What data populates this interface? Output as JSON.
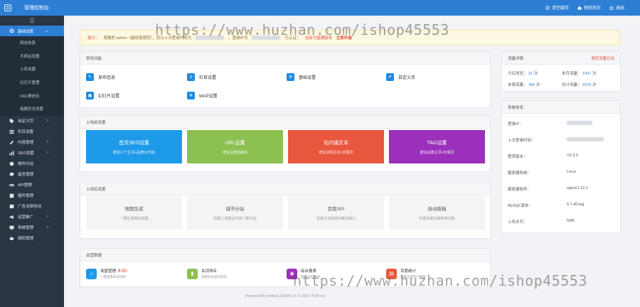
{
  "header": {
    "brand": "管理控制台",
    "tools": [
      {
        "label": "清空缓存",
        "icon": "gear-icon"
      },
      {
        "label": "预览前台",
        "icon": "home-icon"
      },
      {
        "label": "退出",
        "icon": "power-icon"
      }
    ]
  },
  "sidebar": {
    "toggle_icon": "menu-icon",
    "active": {
      "label": "基础设置",
      "icon": "gear-icon"
    },
    "sub_items": [
      "网站信息",
      "手机站设置",
      "上传设置",
      "幻灯片管理",
      "URL静态化",
      "每据安全设置"
    ],
    "items": [
      {
        "label": "自定义页",
        "icon": "tag-icon",
        "chevron": true
      },
      {
        "label": "栏目设置",
        "icon": "list-icon",
        "chevron": false
      },
      {
        "label": "内容管理",
        "icon": "edit-icon",
        "chevron": true
      },
      {
        "label": "SEO设置",
        "icon": "chart-icon",
        "chevron": true
      },
      {
        "label": "城市分站",
        "icon": "globe-icon",
        "chevron": false
      },
      {
        "label": "留言管理",
        "icon": "chat-icon",
        "chevron": false
      },
      {
        "label": "API管理",
        "icon": "link-icon",
        "chevron": false
      },
      {
        "label": "插件管理",
        "icon": "puzzle-icon",
        "chevron": false
      },
      {
        "label": "广告法禁用词",
        "icon": "book-icon",
        "chevron": false
      },
      {
        "label": "运营推广",
        "icon": "megaphone-icon",
        "chevron": true
      },
      {
        "label": "系统管理",
        "icon": "monitor-icon",
        "chevron": true
      },
      {
        "label": "授权管理",
        "icon": "cloud-icon",
        "chevron": false
      }
    ]
  },
  "notice": {
    "prefix": "提示：",
    "text": "尊敬的 admin（超级管理员），您以上次登录时间为",
    "text2": "，登录IP为",
    "text3": "已认证：",
    "highlight": "当前为普通版本",
    "upgrade": "立即升级"
  },
  "common": {
    "title": "常用功能",
    "items": [
      {
        "label": "发布信息",
        "icon": "edit-icon"
      },
      {
        "label": "栏目设置",
        "icon": "list-icon"
      },
      {
        "label": "基础设置",
        "icon": "gear-icon"
      },
      {
        "label": "自定义页",
        "icon": "pen-icon"
      },
      {
        "label": "幻灯片设置",
        "icon": "image-icon"
      },
      {
        "label": "WAP设置",
        "icon": "gear-icon"
      }
    ]
  },
  "before": {
    "title": "上线前设置",
    "cards": [
      {
        "title": "首页SEO设置",
        "sub": "建议三个主词+品牌/公司名",
        "color": "#1e9be8"
      },
      {
        "title": "URL设置",
        "sub": "建议设置伪静态",
        "color": "#8cc152"
      },
      {
        "title": "站内锚文本",
        "sub": "建议添加主词+长尾词",
        "color": "#e9573f"
      },
      {
        "title": "TAG设置",
        "sub": "建议设置主词+长尾词",
        "color": "#9b30ba"
      }
    ]
  },
  "after": {
    "title": "上线后设置",
    "cards": [
      {
        "title": "地图生成",
        "sub": "一键生成网站地图"
      },
      {
        "title": "城市分站",
        "sub": "初期上线建议开启少量分站"
      },
      {
        "title": "百度API",
        "sub": "百度主动及被动推送接口"
      },
      {
        "title": "自动拨箱",
        "sub": "权重依赖全链时等文稿"
      }
    ]
  },
  "ops": {
    "title": "运营数据",
    "items": [
      {
        "title": "询盘管理",
        "badge": "未读0",
        "sub": "一键查看未读询盘",
        "color": "#1e9be8",
        "icon": "inbox-icon"
      },
      {
        "title": "关词排名",
        "badge": "",
        "sub": "查看您的关词排名",
        "color": "#8cc152",
        "icon": "bar-chart-icon"
      },
      {
        "title": "综合报表",
        "badge": "",
        "sub": "网站运营数据",
        "color": "#9b30ba",
        "icon": "report-icon"
      },
      {
        "title": "百度统计",
        "badge": "",
        "sub": "查看百度统计数据",
        "color": "#e9573f",
        "icon": "stats-icon"
      }
    ]
  },
  "traffic": {
    "title": "流量详情",
    "clear": "清空流量日志",
    "rows": [
      {
        "label": "今日浏览：",
        "value": "21",
        "unit": "次"
      },
      {
        "label": "本月流量：",
        "value": "1097",
        "unit": "次"
      },
      {
        "label": "本周流量：",
        "value": "306",
        "unit": "次"
      },
      {
        "label": "总计流量：",
        "value": "9276",
        "unit": "次"
      }
    ]
  },
  "system": {
    "title": "系统信息",
    "rows": [
      {
        "label": "登录IP：",
        "value": ""
      },
      {
        "label": "上次登录时间：",
        "value": ""
      },
      {
        "label": "程序版本：",
        "value": "V2.3.0"
      },
      {
        "label": "服务器系统：",
        "value": "Linux"
      },
      {
        "label": "服务器软件：",
        "value": "nginx/1.22.1"
      },
      {
        "label": "MySQL版本：",
        "value": "5.7.40-log"
      },
      {
        "label": "上传许可：",
        "value": "50M"
      }
    ]
  },
  "footer": "Powered By moban.51987.cn © 2020 YUN Inc.",
  "watermark": "https://www.huzhan.com/ishop45553"
}
